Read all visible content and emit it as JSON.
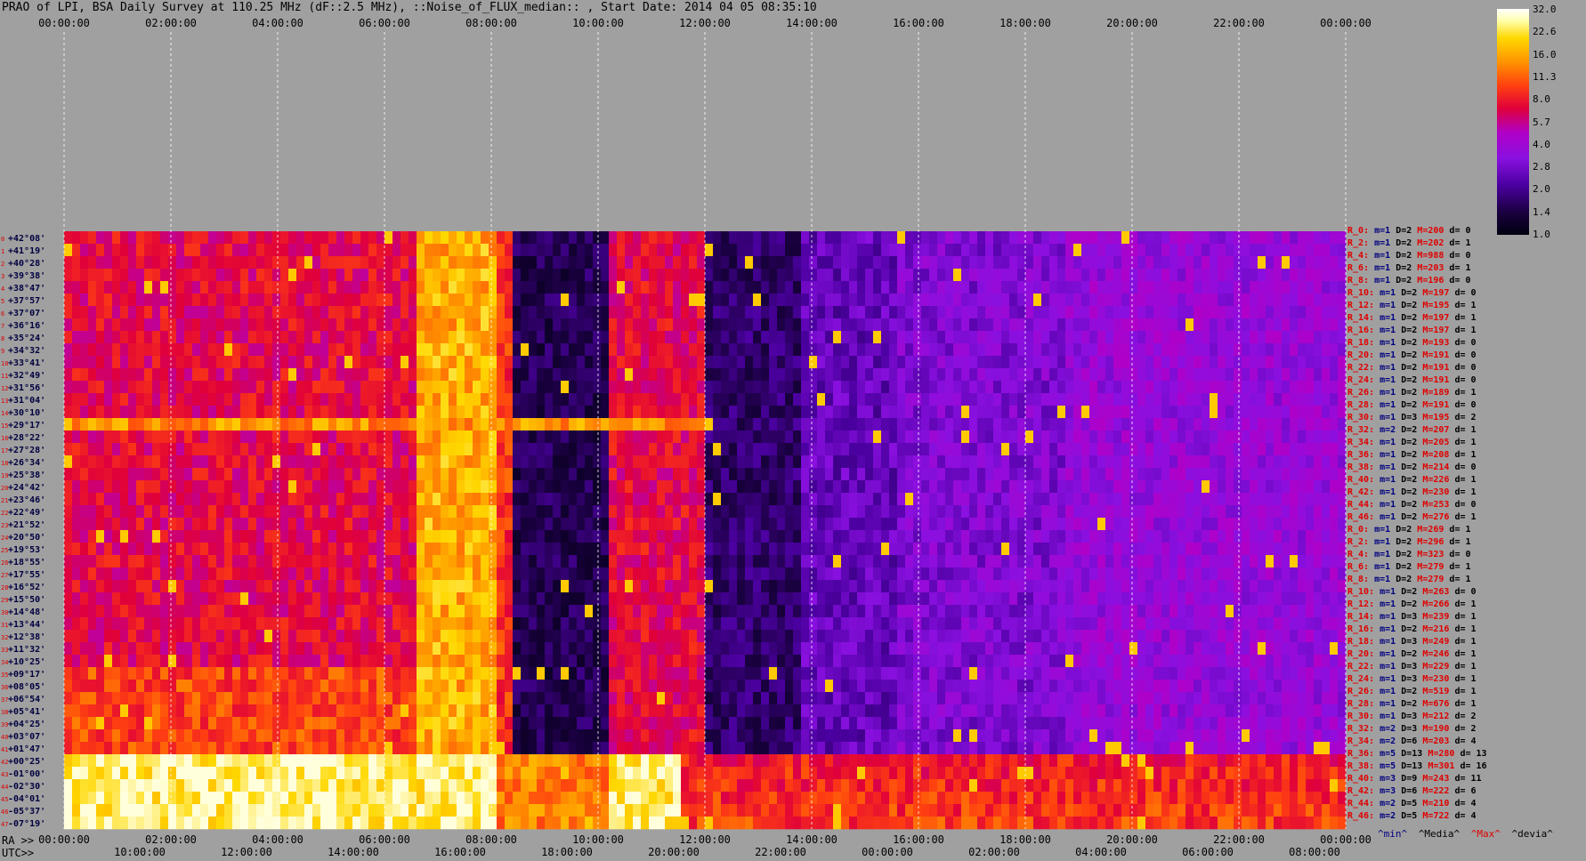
{
  "header": {
    "title": "PRAO of LPI, BSA Daily Survey at 110.25 MHz (dF::2.5 MHz), ::Noise_of_FLUX_median:: , Start Date: 2014 04 05 08:35:10"
  },
  "chart_data": {
    "type": "heatmap",
    "x_top_ticks": [
      "00:00:00",
      "02:00:00",
      "04:00:00",
      "06:00:00",
      "08:00:00",
      "10:00:00",
      "12:00:00",
      "14:00:00",
      "16:00:00",
      "18:00:00",
      "20:00:00",
      "22:00:00",
      "00:00:00"
    ],
    "x_bottom_ra_ticks": [
      "00:00:00",
      "02:00:00",
      "04:00:00",
      "06:00:00",
      "08:00:00",
      "10:00:00",
      "12:00:00",
      "14:00:00",
      "16:00:00",
      "18:00:00",
      "20:00:00",
      "22:00:00",
      "00:00:00"
    ],
    "x_bottom_utc_ticks": [
      "10:00:00",
      "12:00:00",
      "14:00:00",
      "16:00:00",
      "18:00:00",
      "20:00:00",
      "22:00:00",
      "00:00:00",
      "02:00:00",
      "04:00:00",
      "06:00:00",
      "08:00:00"
    ],
    "axis_prefix_ra": "RA >>",
    "axis_prefix_utc": "UTC>>",
    "dec_labels": [
      "+42°08'",
      "+41°19'",
      "+40°28'",
      "+39°38'",
      "+38°47'",
      "+37°57'",
      "+37°07'",
      "+36°16'",
      "+35°24'",
      "+34°32'",
      "+33°41'",
      "+32°49'",
      "+31°56'",
      "+31°04'",
      "+30°10'",
      "+29°17'",
      "+28°22'",
      "+27°28'",
      "+26°34'",
      "+25°38'",
      "+24°42'",
      "+23°46'",
      "+22°49'",
      "+21°52'",
      "+20°50'",
      "+19°53'",
      "+18°55'",
      "+17°55'",
      "+16°52'",
      "+15°50'",
      "+14°48'",
      "+13°44'",
      "+12°38'",
      "+11°32'",
      "+10°25'",
      "+09°17'",
      "+08°05'",
      "+06°54'",
      "+05°41'",
      "+04°25'",
      "+03°07'",
      "+01°47'",
      "+00°25'",
      "-01°00'",
      "-02°30'",
      "-04°01'",
      "-05°37'",
      "-07°19'"
    ],
    "colorbar": {
      "ticks": [
        "32.0",
        "22.6",
        "16.0",
        "11.3",
        "8.0",
        "5.7",
        "4.0",
        "2.8",
        "2.0",
        "1.4",
        "1.0"
      ],
      "log_scale": true,
      "range": [
        1.0,
        32.0
      ]
    },
    "row_stats": [
      {
        "ray": "R_0:",
        "min": "m=1",
        "d": "D=2",
        "max": "M=200",
        "dev": "d= 0"
      },
      {
        "ray": "R_2:",
        "min": "m=1",
        "d": "D=2",
        "max": "M=202",
        "dev": "d= 1"
      },
      {
        "ray": "R_4:",
        "min": "m=1",
        "d": "D=2",
        "max": "M=988",
        "dev": "d= 0"
      },
      {
        "ray": "R_6:",
        "min": "m=1",
        "d": "D=2",
        "max": "M=203",
        "dev": "d= 1"
      },
      {
        "ray": "R_8:",
        "min": "m=1",
        "d": "D=2",
        "max": "M=196",
        "dev": "d= 0"
      },
      {
        "ray": "R_10:",
        "min": "m=1",
        "d": "D=2",
        "max": "M=197",
        "dev": "d= 0"
      },
      {
        "ray": "R_12:",
        "min": "m=1",
        "d": "D=2",
        "max": "M=195",
        "dev": "d= 1"
      },
      {
        "ray": "R_14:",
        "min": "m=1",
        "d": "D=2",
        "max": "M=197",
        "dev": "d= 1"
      },
      {
        "ray": "R_16:",
        "min": "m=1",
        "d": "D=2",
        "max": "M=197",
        "dev": "d= 1"
      },
      {
        "ray": "R_18:",
        "min": "m=1",
        "d": "D=2",
        "max": "M=193",
        "dev": "d= 0"
      },
      {
        "ray": "R_20:",
        "min": "m=1",
        "d": "D=2",
        "max": "M=191",
        "dev": "d= 0"
      },
      {
        "ray": "R_22:",
        "min": "m=1",
        "d": "D=2",
        "max": "M=191",
        "dev": "d= 0"
      },
      {
        "ray": "R_24:",
        "min": "m=1",
        "d": "D=2",
        "max": "M=191",
        "dev": "d= 0"
      },
      {
        "ray": "R_26:",
        "min": "m=1",
        "d": "D=2",
        "max": "M=189",
        "dev": "d= 1"
      },
      {
        "ray": "R_28:",
        "min": "m=1",
        "d": "D=2",
        "max": "M=191",
        "dev": "d= 0"
      },
      {
        "ray": "R_30:",
        "min": "m=1",
        "d": "D=3",
        "max": "M=195",
        "dev": "d= 2"
      },
      {
        "ray": "R_32:",
        "min": "m=2",
        "d": "D=2",
        "max": "M=207",
        "dev": "d= 1"
      },
      {
        "ray": "R_34:",
        "min": "m=1",
        "d": "D=2",
        "max": "M=205",
        "dev": "d= 1"
      },
      {
        "ray": "R_36:",
        "min": "m=1",
        "d": "D=2",
        "max": "M=208",
        "dev": "d= 1"
      },
      {
        "ray": "R_38:",
        "min": "m=1",
        "d": "D=2",
        "max": "M=214",
        "dev": "d= 0"
      },
      {
        "ray": "R_40:",
        "min": "m=1",
        "d": "D=2",
        "max": "M=226",
        "dev": "d= 1"
      },
      {
        "ray": "R_42:",
        "min": "m=1",
        "d": "D=2",
        "max": "M=230",
        "dev": "d= 1"
      },
      {
        "ray": "R_44:",
        "min": "m=1",
        "d": "D=2",
        "max": "M=253",
        "dev": "d= 0"
      },
      {
        "ray": "R_46:",
        "min": "m=1",
        "d": "D=2",
        "max": "M=276",
        "dev": "d= 1"
      },
      {
        "ray": "R_0:",
        "min": "m=1",
        "d": "D=2",
        "max": "M=269",
        "dev": "d= 1"
      },
      {
        "ray": "R_2:",
        "min": "m=1",
        "d": "D=2",
        "max": "M=296",
        "dev": "d= 1"
      },
      {
        "ray": "R_4:",
        "min": "m=1",
        "d": "D=2",
        "max": "M=323",
        "dev": "d= 0"
      },
      {
        "ray": "R_6:",
        "min": "m=1",
        "d": "D=2",
        "max": "M=279",
        "dev": "d= 1"
      },
      {
        "ray": "R_8:",
        "min": "m=1",
        "d": "D=2",
        "max": "M=279",
        "dev": "d= 1"
      },
      {
        "ray": "R_10:",
        "min": "m=1",
        "d": "D=2",
        "max": "M=263",
        "dev": "d= 0"
      },
      {
        "ray": "R_12:",
        "min": "m=1",
        "d": "D=2",
        "max": "M=266",
        "dev": "d= 1"
      },
      {
        "ray": "R_14:",
        "min": "m=1",
        "d": "D=3",
        "max": "M=239",
        "dev": "d= 1"
      },
      {
        "ray": "R_16:",
        "min": "m=1",
        "d": "D=2",
        "max": "M=216",
        "dev": "d= 1"
      },
      {
        "ray": "R_18:",
        "min": "m=1",
        "d": "D=3",
        "max": "M=249",
        "dev": "d= 1"
      },
      {
        "ray": "R_20:",
        "min": "m=1",
        "d": "D=2",
        "max": "M=246",
        "dev": "d= 1"
      },
      {
        "ray": "R_22:",
        "min": "m=1",
        "d": "D=3",
        "max": "M=229",
        "dev": "d= 1"
      },
      {
        "ray": "R_24:",
        "min": "m=1",
        "d": "D=3",
        "max": "M=230",
        "dev": "d= 1"
      },
      {
        "ray": "R_26:",
        "min": "m=1",
        "d": "D=2",
        "max": "M=519",
        "dev": "d= 1"
      },
      {
        "ray": "R_28:",
        "min": "m=1",
        "d": "D=2",
        "max": "M=676",
        "dev": "d= 1"
      },
      {
        "ray": "R_30:",
        "min": "m=1",
        "d": "D=3",
        "max": "M=212",
        "dev": "d= 2"
      },
      {
        "ray": "R_32:",
        "min": "m=2",
        "d": "D=3",
        "max": "M=190",
        "dev": "d= 2"
      },
      {
        "ray": "R_34:",
        "min": "m=2",
        "d": "D=6",
        "max": "M=203",
        "dev": "d= 4"
      },
      {
        "ray": "R_36:",
        "min": "m=5",
        "d": "D=13",
        "max": "M=280",
        "dev": "d= 13"
      },
      {
        "ray": "R_38:",
        "min": "m=5",
        "d": "D=13",
        "max": "M=301",
        "dev": "d= 16"
      },
      {
        "ray": "R_40:",
        "min": "m=3",
        "d": "D=9",
        "max": "M=243",
        "dev": "d= 11"
      },
      {
        "ray": "R_42:",
        "min": "m=3",
        "d": "D=6",
        "max": "M=222",
        "dev": "d= 6"
      },
      {
        "ray": "R_44:",
        "min": "m=2",
        "d": "D=5",
        "max": "M=210",
        "dev": "d= 4"
      },
      {
        "ray": "R_46:",
        "min": "m=2",
        "d": "D=5",
        "max": "M=722",
        "dev": "d= 4"
      }
    ],
    "stat_legend": [
      "^min^",
      "^Media^",
      "^Max^",
      "^devia^"
    ]
  },
  "colors": {
    "background": "#a0a0a0",
    "ray_label": "#e00000",
    "min_label": "#000080",
    "max_label": "#e00000"
  }
}
